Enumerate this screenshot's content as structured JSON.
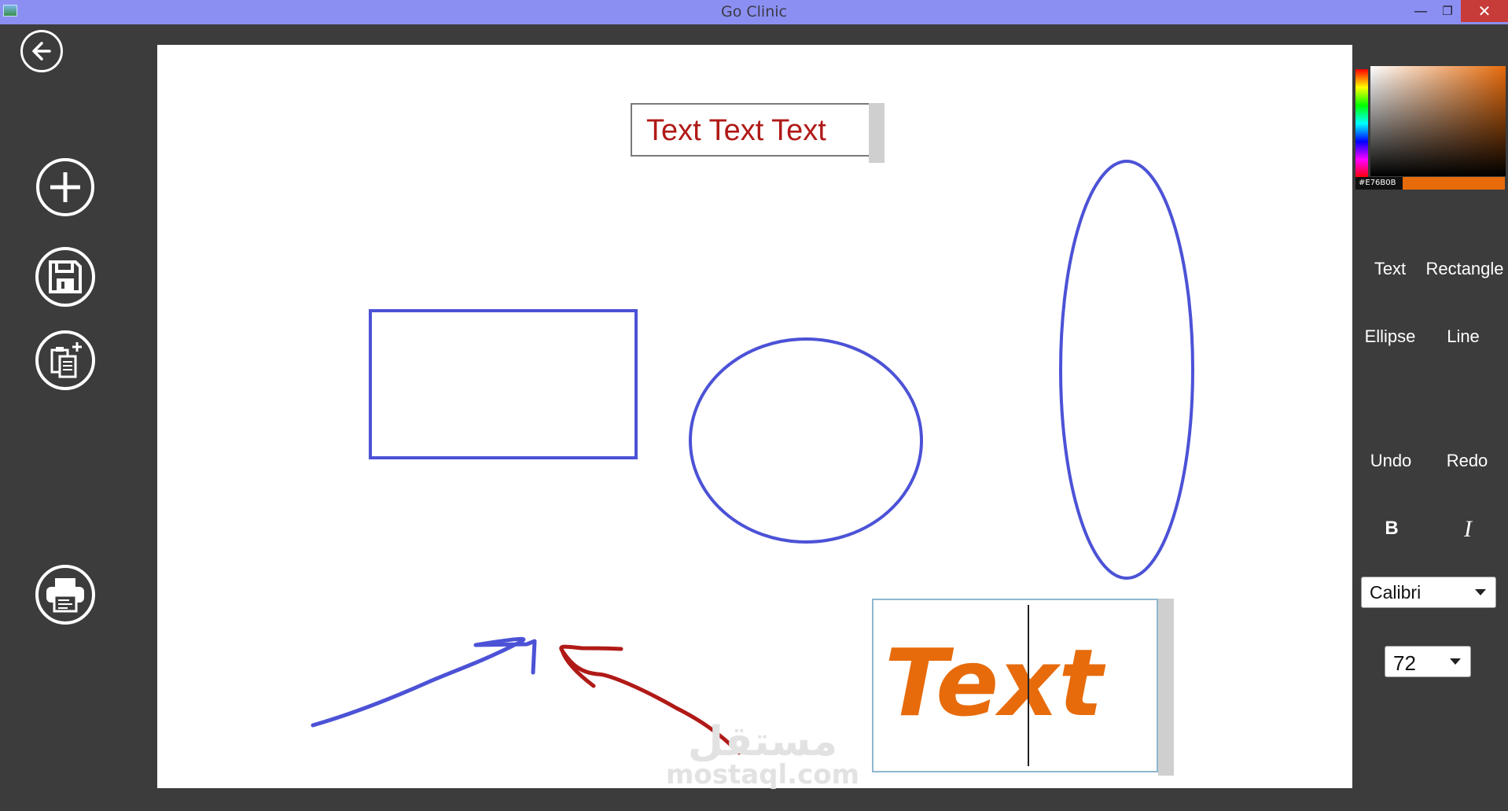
{
  "window": {
    "title": "Go Clinic",
    "minimize_glyph": "—",
    "maximize_glyph": "❐",
    "close_glyph": "✕"
  },
  "sidebar": {
    "icons": [
      "back-arrow-icon",
      "add-icon",
      "save-icon",
      "paste-icon",
      "print-icon"
    ]
  },
  "canvas": {
    "textbox_small": {
      "text": "Text Text Text",
      "color": "#b01a17"
    },
    "textbox_large": {
      "text": "Text",
      "color": "#e76b0b"
    },
    "watermark": {
      "arabic": "مستقل",
      "latin": "mostaql.com"
    },
    "shape_stroke_color": "#4c52d6",
    "freehand_red_color": "#b01a17"
  },
  "color_picker": {
    "hex": "#E76B0B",
    "selected_color": "#e76b0b"
  },
  "tools": {
    "text": "Text",
    "rectangle": "Rectangle",
    "ellipse": "Ellipse",
    "line": "Line",
    "undo": "Undo",
    "redo": "Redo",
    "bold": "B",
    "italic": "I"
  },
  "font_family_select": {
    "value": "Calibri"
  },
  "font_size_select": {
    "value": "72"
  }
}
